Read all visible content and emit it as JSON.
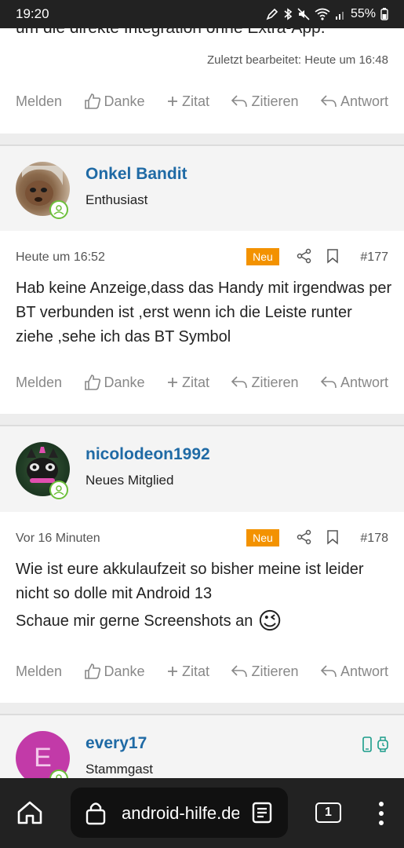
{
  "status_bar": {
    "time": "19:20",
    "battery": "55%"
  },
  "post_top": {
    "partial_text": "um die direkte Integration ohne Extra-App.",
    "edited": "Zuletzt bearbeitet: Heute um 16:48"
  },
  "actions": {
    "report": "Melden",
    "thanks": "Danke",
    "quote_add": "Zitat",
    "quote": "Zitieren",
    "reply": "Antwort"
  },
  "posts": [
    {
      "username": "Onkel Bandit",
      "role": "Enthusiast",
      "time": "Heute um 16:52",
      "badge": "Neu",
      "number": "#177",
      "text": "Hab keine Anzeige,dass das Handy mit irgendwas per BT verbunden ist ,erst wenn ich die Leiste runter ziehe ,sehe ich das BT Symbol"
    },
    {
      "username": "nicolodeon1992",
      "role": "Neues Mitglied",
      "time": "Vor 16 Minuten",
      "badge": "Neu",
      "number": "#178",
      "text": "Wie ist eure akkulaufzeit so bisher meine ist leider nicht so dolle mit Android 13",
      "text2": "Schaue mir gerne Screenshots an",
      "emoji": "😉"
    },
    {
      "username": "every17",
      "role": "Stammgast",
      "avatar_letter": "E"
    }
  ],
  "browser": {
    "url": "android-hilfe.de",
    "tab_count": "1"
  },
  "colors": {
    "accent": "#1f6aa5",
    "badge": "#f39200",
    "avatar_e": "#c23aa8",
    "online": "#6cbf3a"
  }
}
